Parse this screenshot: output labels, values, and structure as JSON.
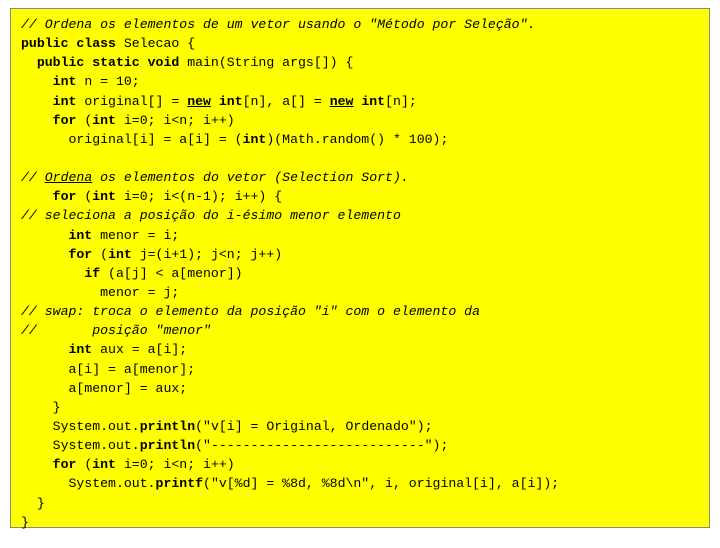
{
  "code": {
    "lines": [
      [
        {
          "t": "// Ordena os elementos de um vetor usando o \"Método por Seleção\".",
          "c": "cm"
        }
      ],
      [
        {
          "t": "public class",
          "c": "kw"
        },
        {
          "t": " Selecao {"
        }
      ],
      [
        {
          "t": "  "
        },
        {
          "t": "public static void",
          "c": "kw"
        },
        {
          "t": " main(String args[]) {"
        }
      ],
      [
        {
          "t": "    "
        },
        {
          "t": "int",
          "c": "kw"
        },
        {
          "t": " n = 10;"
        }
      ],
      [
        {
          "t": "    "
        },
        {
          "t": "int",
          "c": "kw"
        },
        {
          "t": " original[] = "
        },
        {
          "t": "new",
          "c": "kw ul"
        },
        {
          "t": " "
        },
        {
          "t": "int",
          "c": "kw"
        },
        {
          "t": "[n], a[] = "
        },
        {
          "t": "new",
          "c": "kw ul"
        },
        {
          "t": " "
        },
        {
          "t": "int",
          "c": "kw"
        },
        {
          "t": "[n];"
        }
      ],
      [
        {
          "t": "    "
        },
        {
          "t": "for",
          "c": "kw"
        },
        {
          "t": " ("
        },
        {
          "t": "int",
          "c": "kw"
        },
        {
          "t": " i=0; i<n; i++)"
        }
      ],
      [
        {
          "t": "      original[i] = a[i] = ("
        },
        {
          "t": "int",
          "c": "kw"
        },
        {
          "t": ")(Math.random() * 100);"
        }
      ],
      [
        {
          "t": " "
        }
      ],
      [
        {
          "t": "// ",
          "c": "cm"
        },
        {
          "t": "Ordena",
          "c": "cm ul"
        },
        {
          "t": " os elementos do vetor (Selection Sort).",
          "c": "cm"
        }
      ],
      [
        {
          "t": "    "
        },
        {
          "t": "for",
          "c": "kw"
        },
        {
          "t": " ("
        },
        {
          "t": "int",
          "c": "kw"
        },
        {
          "t": " i=0; i<(n-1); i++) {"
        }
      ],
      [
        {
          "t": "// seleciona a posição do i-ésimo menor elemento",
          "c": "cm"
        }
      ],
      [
        {
          "t": "      "
        },
        {
          "t": "int",
          "c": "kw"
        },
        {
          "t": " menor = i;"
        }
      ],
      [
        {
          "t": "      "
        },
        {
          "t": "for",
          "c": "kw"
        },
        {
          "t": " ("
        },
        {
          "t": "int",
          "c": "kw"
        },
        {
          "t": " j=(i+1); j<n; j++)"
        }
      ],
      [
        {
          "t": "        "
        },
        {
          "t": "if",
          "c": "kw"
        },
        {
          "t": " (a[j] < a[menor])"
        }
      ],
      [
        {
          "t": "          menor = j;"
        }
      ],
      [
        {
          "t": "// swap: troca o elemento da posição \"i\" com o elemento da",
          "c": "cm"
        }
      ],
      [
        {
          "t": "//       posição \"menor\"",
          "c": "cm"
        }
      ],
      [
        {
          "t": "      "
        },
        {
          "t": "int",
          "c": "kw"
        },
        {
          "t": " aux = a[i];"
        }
      ],
      [
        {
          "t": "      a[i] = a[menor];"
        }
      ],
      [
        {
          "t": "      a[menor] = aux;"
        }
      ],
      [
        {
          "t": "    }"
        }
      ],
      [
        {
          "t": "    System.out."
        },
        {
          "t": "println",
          "c": "kw"
        },
        {
          "t": "(\"v[i] = Original, Ordenado\");"
        }
      ],
      [
        {
          "t": "    System.out."
        },
        {
          "t": "println",
          "c": "kw"
        },
        {
          "t": "(\"---------------------------\");"
        }
      ],
      [
        {
          "t": "    "
        },
        {
          "t": "for",
          "c": "kw"
        },
        {
          "t": " ("
        },
        {
          "t": "int",
          "c": "kw"
        },
        {
          "t": " i=0; i<n; i++)"
        }
      ],
      [
        {
          "t": "      System.out."
        },
        {
          "t": "printf",
          "c": "kw"
        },
        {
          "t": "(\"v[%d] = %8d, %8d\\n\", i, original[i], a[i]);"
        }
      ],
      [
        {
          "t": "  }"
        }
      ],
      [
        {
          "t": "}"
        }
      ]
    ]
  }
}
